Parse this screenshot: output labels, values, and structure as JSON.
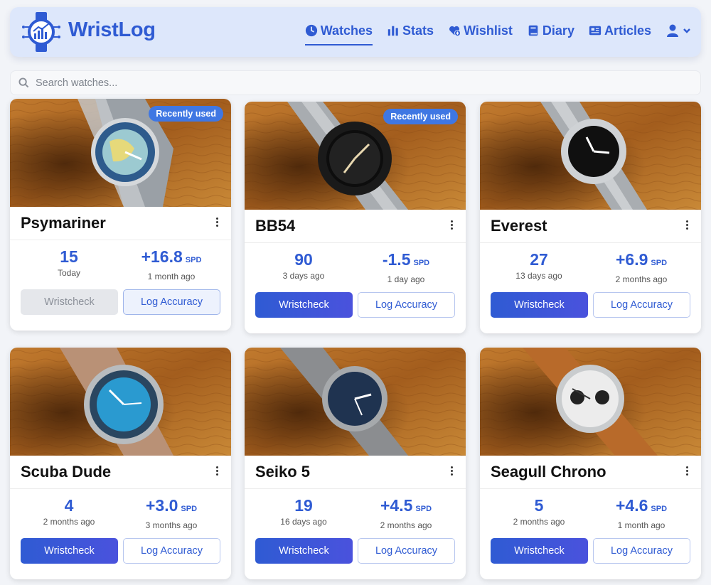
{
  "app": {
    "name": "WristLog"
  },
  "nav": {
    "items": [
      {
        "label": "Watches",
        "icon": "clock-icon",
        "active": true
      },
      {
        "label": "Stats",
        "icon": "bar-chart-icon",
        "active": false
      },
      {
        "label": "Wishlist",
        "icon": "heart-plus-icon",
        "active": false
      },
      {
        "label": "Diary",
        "icon": "book-icon",
        "active": false
      },
      {
        "label": "Articles",
        "icon": "newspaper-icon",
        "active": false
      }
    ],
    "user_icon": "user-icon"
  },
  "search": {
    "placeholder": "Search watches..."
  },
  "colors": {
    "accent": "#2f5bd3",
    "badge": "#3f77e3",
    "header_bg": "#dde7fb"
  },
  "watches": [
    {
      "name": "Psymariner",
      "badge": "Recently used",
      "count": "15",
      "count_label": "Today",
      "accuracy": "+16.8",
      "unit": "SPD",
      "accuracy_label": "1 month ago",
      "wristcheck": "Wristcheck",
      "log": "Log Accuracy",
      "wristcheck_disabled": true
    },
    {
      "name": "BB54",
      "badge": "Recently used",
      "count": "90",
      "count_label": "3 days ago",
      "accuracy": "-1.5",
      "unit": "SPD",
      "accuracy_label": "1 day ago",
      "wristcheck": "Wristcheck",
      "log": "Log Accuracy",
      "wristcheck_disabled": false
    },
    {
      "name": "Everest",
      "badge": "",
      "count": "27",
      "count_label": "13 days ago",
      "accuracy": "+6.9",
      "unit": "SPD",
      "accuracy_label": "2 months ago",
      "wristcheck": "Wristcheck",
      "log": "Log Accuracy",
      "wristcheck_disabled": false
    },
    {
      "name": "Scuba Dude",
      "badge": "",
      "count": "4",
      "count_label": "2 months ago",
      "accuracy": "+3.0",
      "unit": "SPD",
      "accuracy_label": "3 months ago",
      "wristcheck": "Wristcheck",
      "log": "Log Accuracy",
      "wristcheck_disabled": false
    },
    {
      "name": "Seiko 5",
      "badge": "",
      "count": "19",
      "count_label": "16 days ago",
      "accuracy": "+4.5",
      "unit": "SPD",
      "accuracy_label": "2 months ago",
      "wristcheck": "Wristcheck",
      "log": "Log Accuracy",
      "wristcheck_disabled": false
    },
    {
      "name": "Seagull Chrono",
      "badge": "",
      "count": "5",
      "count_label": "2 months ago",
      "accuracy": "+4.6",
      "unit": "SPD",
      "accuracy_label": "1 month ago",
      "wristcheck": "Wristcheck",
      "log": "Log Accuracy",
      "wristcheck_disabled": false
    }
  ]
}
